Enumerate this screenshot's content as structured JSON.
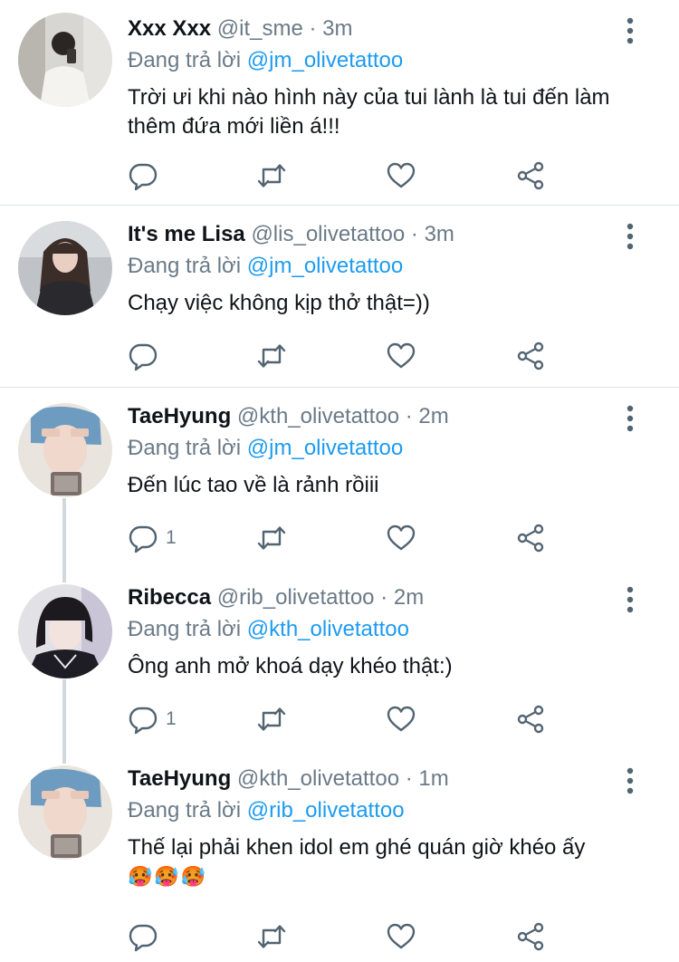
{
  "reply_prefix": "Đang trả lời",
  "tweets": [
    {
      "name": "Xxx Xxx",
      "handle": "@it_sme",
      "separator": "·",
      "time": "3m",
      "replying_to": "@jm_olivetattoo",
      "text": "Trời ưi khi nào hình này của tui lành là tui đến làm thêm đứa mới liền á!!!",
      "emojis": "",
      "reply_count": ""
    },
    {
      "name": "It's me Lisa",
      "handle": "@lis_olivetattoo",
      "separator": "·",
      "time": "3m",
      "replying_to": "@jm_olivetattoo",
      "text": "Chạy việc không kịp thở thật=))",
      "emojis": "",
      "reply_count": ""
    },
    {
      "name": "TaeHyung",
      "handle": "@kth_olivetattoo",
      "separator": "·",
      "time": "2m",
      "replying_to": "@jm_olivetattoo",
      "text": "Đến lúc tao về là rảnh rồiii",
      "emojis": "",
      "reply_count": "1"
    },
    {
      "name": "Ribecca",
      "handle": "@rib_olivetattoo",
      "separator": "·",
      "time": "2m",
      "replying_to": "@kth_olivetattoo",
      "text": "Ông anh mở khoá dạy khéo thật:)",
      "emojis": "",
      "reply_count": "1"
    },
    {
      "name": "TaeHyung",
      "handle": "@kth_olivetattoo",
      "separator": "·",
      "time": "1m",
      "replying_to": "@rib_olivetattoo",
      "text": "Thế lại phải khen idol em ghé quán giờ khéo ấy",
      "emojis": "🥵🥵🥵",
      "reply_count": ""
    }
  ],
  "icons": {
    "reply": "reply-icon",
    "retweet": "retweet-icon",
    "like": "heart-icon",
    "share": "share-icon",
    "more": "more-options-icon"
  },
  "colors": {
    "mention": "#1d9bf0",
    "secondary_text": "#6b7a87",
    "primary_text": "#0f1419",
    "divider": "#dfe3e6",
    "thread_line": "#cfd9de"
  }
}
